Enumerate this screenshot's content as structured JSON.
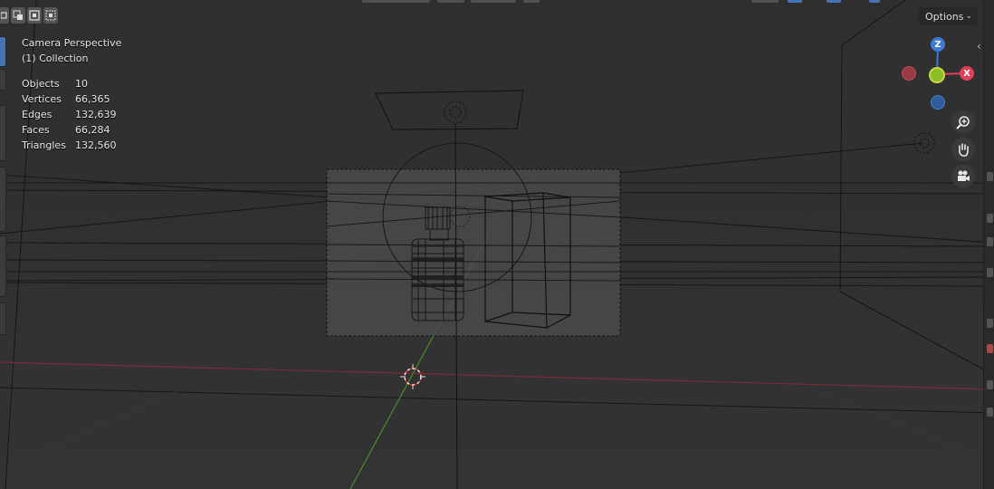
{
  "viewport": {
    "mode_label": "Camera Perspective",
    "collection_label": "(1) Collection"
  },
  "stats": [
    {
      "label": "Objects",
      "value": "10"
    },
    {
      "label": "Vertices",
      "value": "66,365"
    },
    {
      "label": "Edges",
      "value": "132,639"
    },
    {
      "label": "Faces",
      "value": "66,284"
    },
    {
      "label": "Triangles",
      "value": "132,560"
    }
  ],
  "header": {
    "options_label": "Options",
    "chevron": "⌄"
  },
  "gizmo": {
    "z_label": "Z",
    "x_label": "X",
    "colors": {
      "x": "#e04055",
      "y": "#8bbf26",
      "z": "#3d7ad6",
      "neg_x": "#9a3a45",
      "neg_z": "#2f5d9e"
    }
  },
  "icons": {
    "zoom": "zoom-in-icon",
    "pan": "hand-icon",
    "camera": "camera-icon"
  }
}
